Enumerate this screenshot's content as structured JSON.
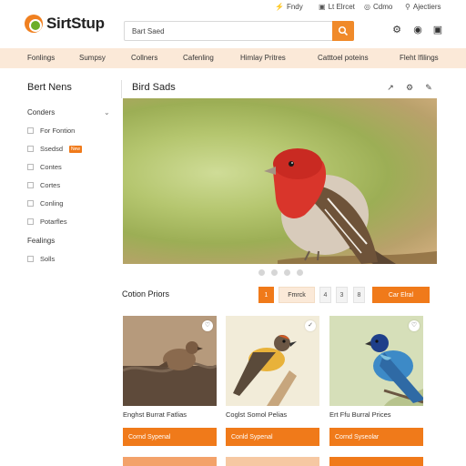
{
  "utility_bar": {
    "items": [
      {
        "icon": "lightning-icon",
        "label": "Fndy"
      },
      {
        "icon": "bag-icon",
        "label": "Lt Elrcet"
      },
      {
        "icon": "headset-icon",
        "label": "Cdmo"
      },
      {
        "icon": "user-icon",
        "label": "Ajectiers"
      }
    ]
  },
  "header": {
    "logo_text": "SirtStup",
    "search": {
      "value": "Bart Saed",
      "placeholder": ""
    },
    "icons": [
      "settings-icon",
      "account-icon",
      "cart-icon"
    ]
  },
  "nav": {
    "items": [
      "Fonlings",
      "Sumpsy",
      "Collners",
      "Cafenling",
      "Himlay Pritres",
      "Catttoel poteins",
      "Fleht Ifilings"
    ]
  },
  "sidebar": {
    "title": "Bert Nens",
    "group1": "Conders",
    "checkboxes": [
      {
        "label": "For Fontion"
      },
      {
        "label": "Ssedsd",
        "tag": "New"
      },
      {
        "label": "Contes"
      },
      {
        "label": "Cortes"
      },
      {
        "label": "Conling"
      },
      {
        "label": "Potarfles"
      }
    ],
    "group2": "Fealings",
    "group2_items": [
      {
        "label": "Solls"
      }
    ]
  },
  "main": {
    "title": "Bird Sads",
    "toolbar_icons": [
      "link-icon",
      "settings-icon",
      "edit-icon"
    ],
    "carousel_dots": 4,
    "collection": {
      "title": "Cotion Priors",
      "pager": {
        "active": "1",
        "filter": "Fmrck",
        "pages": [
          "4",
          "3",
          "8"
        ],
        "cta": "Car Elral"
      }
    },
    "products": [
      {
        "name": "Enghst Burrat Fatlias",
        "button": "Cornd Sypenal",
        "badge_icon": "heart-icon"
      },
      {
        "name": "Coglst Somol Pelias",
        "button": "Conld Sypenal",
        "badge_icon": "check-icon"
      },
      {
        "name": "Ert Ffu Burral Prices",
        "button": "Cornd Syseolar",
        "badge_icon": "heart-icon"
      }
    ]
  },
  "colors": {
    "accent": "#f07a1a",
    "nav_bg": "#fbe9d8",
    "text": "#333333"
  }
}
